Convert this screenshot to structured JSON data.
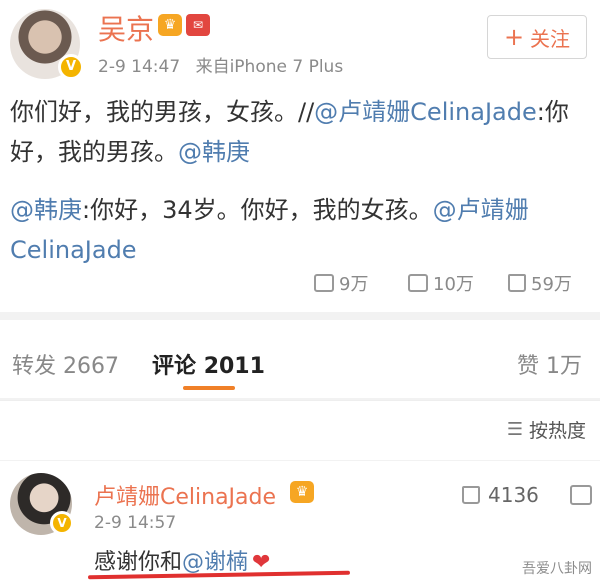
{
  "post": {
    "author": "吴京",
    "timestamp": "2-9 14:47",
    "source": "来自iPhone 7 Plus",
    "follow_label": "关注",
    "text_part1": "你们好，我的男孩，女孩。//",
    "mention1": "@卢靖姗CelinaJade",
    "text_part2": ":你好，我的男孩。",
    "mention2": "@韩庚",
    "repost_mention1": "@韩庚",
    "repost_text": ":你好，34岁。你好，我的女孩。",
    "repost_mention2": "@卢靖姗CelinaJade",
    "actions": {
      "forward": "9万",
      "comment": "10万",
      "like": "59万"
    }
  },
  "tabs": {
    "repost_label": "转发",
    "repost_count": "2667",
    "comment_label": "评论",
    "comment_count": "2011",
    "like_label": "赞",
    "like_count": "1万"
  },
  "sort": {
    "label": "按热度"
  },
  "comment": {
    "author": "卢靖姗CelinaJade",
    "timestamp": "2-9 14:57",
    "text_part": "感谢你和",
    "mention": "@谢楠",
    "likes": "4136"
  },
  "watermark": "吾爱八卦网",
  "colors": {
    "orange": "#eb7350",
    "link": "#507daf",
    "accent": "#f08028",
    "red": "#e0302f"
  }
}
